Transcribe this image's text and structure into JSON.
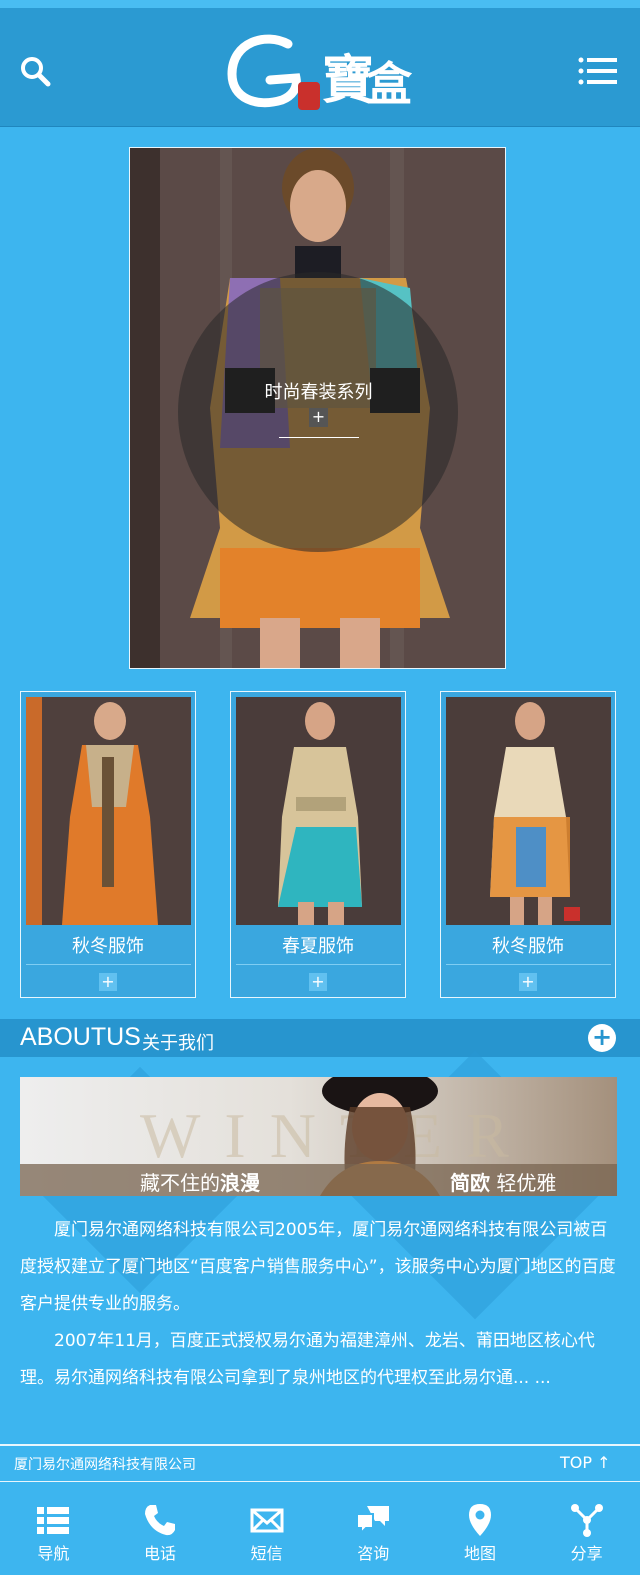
{
  "header": {
    "logo_text": "G寶盒",
    "search_icon": "search-icon",
    "menu_icon": "menu-icon"
  },
  "hero": {
    "title": "时尚春装系列",
    "plus": "+"
  },
  "products": [
    {
      "name": "秋冬服饰",
      "plus": "+"
    },
    {
      "name": "春夏服饰",
      "plus": "+"
    },
    {
      "name": "秋冬服饰",
      "plus": "+"
    }
  ],
  "about": {
    "title_en": "ABOUTUS",
    "title_cn": "关于我们",
    "more": "+",
    "banner": {
      "bg_word": "WINTER",
      "left_text": "藏不住的",
      "left_bold": "浪漫",
      "right_bold": "简欧",
      "right_text": "轻优雅"
    },
    "paragraphs": [
      "厦门易尔通网络科技有限公司2005年，厦门易尔通网络科技有限公司被百度授权建立了厦门地区“百度客户销售服务中心”，该服务中心为厦门地区的百度客户提供专业的服务。",
      "2007年11月，百度正式授权易尔通为福建漳州、龙岩、莆田地区核心代理。易尔通网络科技有限公司拿到了泉州地区的代理权至此易尔通... ..."
    ]
  },
  "footer": {
    "company": "厦门易尔通网络科技有限公司",
    "top": "TOP ↑"
  },
  "nav": [
    {
      "label": "导航",
      "icon": "list-icon"
    },
    {
      "label": "电话",
      "icon": "phone-icon"
    },
    {
      "label": "短信",
      "icon": "mail-icon"
    },
    {
      "label": "咨询",
      "icon": "chat-icon"
    },
    {
      "label": "地图",
      "icon": "map-pin-icon"
    },
    {
      "label": "分享",
      "icon": "share-icon"
    }
  ],
  "colors": {
    "background": "#3db5ef",
    "header": "#2b9ad2",
    "about_bar": "#2795cf"
  }
}
